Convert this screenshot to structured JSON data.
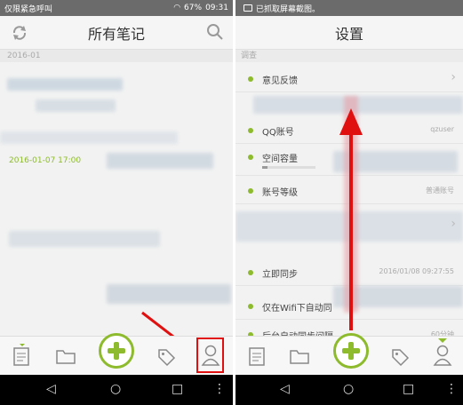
{
  "left": {
    "status": {
      "carrier": "仅限紧急呼叫",
      "battery": "67%",
      "time": "09:31"
    },
    "title": "所有笔记",
    "date_header": "2016-01",
    "note_date": "2016-01-07 17:00",
    "icons": {
      "sync": "sync-icon",
      "search": "search-icon"
    }
  },
  "right": {
    "status": {
      "text": "已抓取屏幕截图。"
    },
    "title": "设置",
    "section": "调查",
    "rows": [
      {
        "label": "意见反馈",
        "value": ""
      },
      {
        "label": "QQ账号",
        "value": "qzuser"
      },
      {
        "label": "空间容量",
        "value": ""
      },
      {
        "label": "账号等级",
        "value": "普通账号"
      },
      {
        "label": "立即同步",
        "value": "2016/01/08 09:27:55"
      },
      {
        "label": "仅在Wifi下自动同",
        "value": ""
      },
      {
        "label": "后台自动同步间隔",
        "value": "60分钟"
      }
    ]
  },
  "nav": [
    "note-icon",
    "folder-icon",
    "add-icon",
    "tag-icon",
    "user-icon"
  ],
  "android": [
    "back-icon",
    "home-icon",
    "recents-icon",
    "more-icon"
  ],
  "colors": {
    "accent": "#8dbb2d",
    "annotation": "#e01010"
  }
}
